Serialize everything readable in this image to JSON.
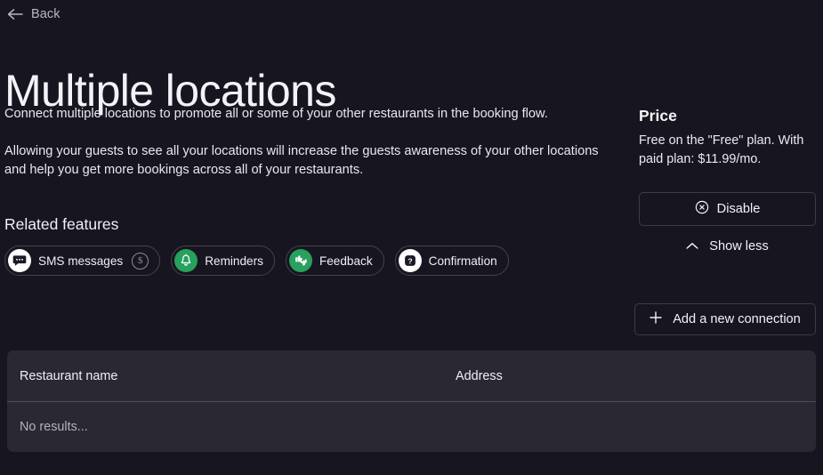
{
  "nav": {
    "back_label": "Back",
    "back_icon": "arrow-left-icon"
  },
  "header": {
    "title": "Multiple locations"
  },
  "description": {
    "paragraph_1": "Connect multiple locations to promote all or some of your other restaurants in the booking flow.",
    "paragraph_2": "Allowing your guests to see all your locations will increase the guests awareness of your other locations and help you get more bookings across all of your restaurants."
  },
  "related_features": {
    "heading": "Related features",
    "items": [
      {
        "label": "SMS messages",
        "icon": "sms-message-icon",
        "icon_style": "white",
        "badge": "$",
        "badge_icon": "dollar-circle-icon"
      },
      {
        "label": "Reminders",
        "icon": "bell-icon",
        "icon_style": "green",
        "badge": null
      },
      {
        "label": "Feedback",
        "icon": "thumbs-icon",
        "icon_style": "green",
        "badge": null
      },
      {
        "label": "Confirmation",
        "icon": "question-mark-icon",
        "icon_style": "white",
        "badge": null
      }
    ]
  },
  "sidebar": {
    "price_heading": "Price",
    "price_text": "Free on the \"Free\" plan. With paid plan: $11.99/mo.",
    "disable_label": "Disable",
    "disable_icon": "circle-x-icon",
    "show_less_label": "Show less",
    "show_less_icon": "chevron-up-icon",
    "add_connection_label": "Add a new connection",
    "add_connection_icon": "plus-icon"
  },
  "table": {
    "columns": [
      "Restaurant name",
      "Address"
    ],
    "rows": [],
    "empty_message": "No results..."
  },
  "colors": {
    "page_background": "#17151f",
    "panel_background": "#2a2833",
    "accent_green": "#28a05e",
    "border": "#45434f",
    "muted_text": "#b4b0c0"
  }
}
